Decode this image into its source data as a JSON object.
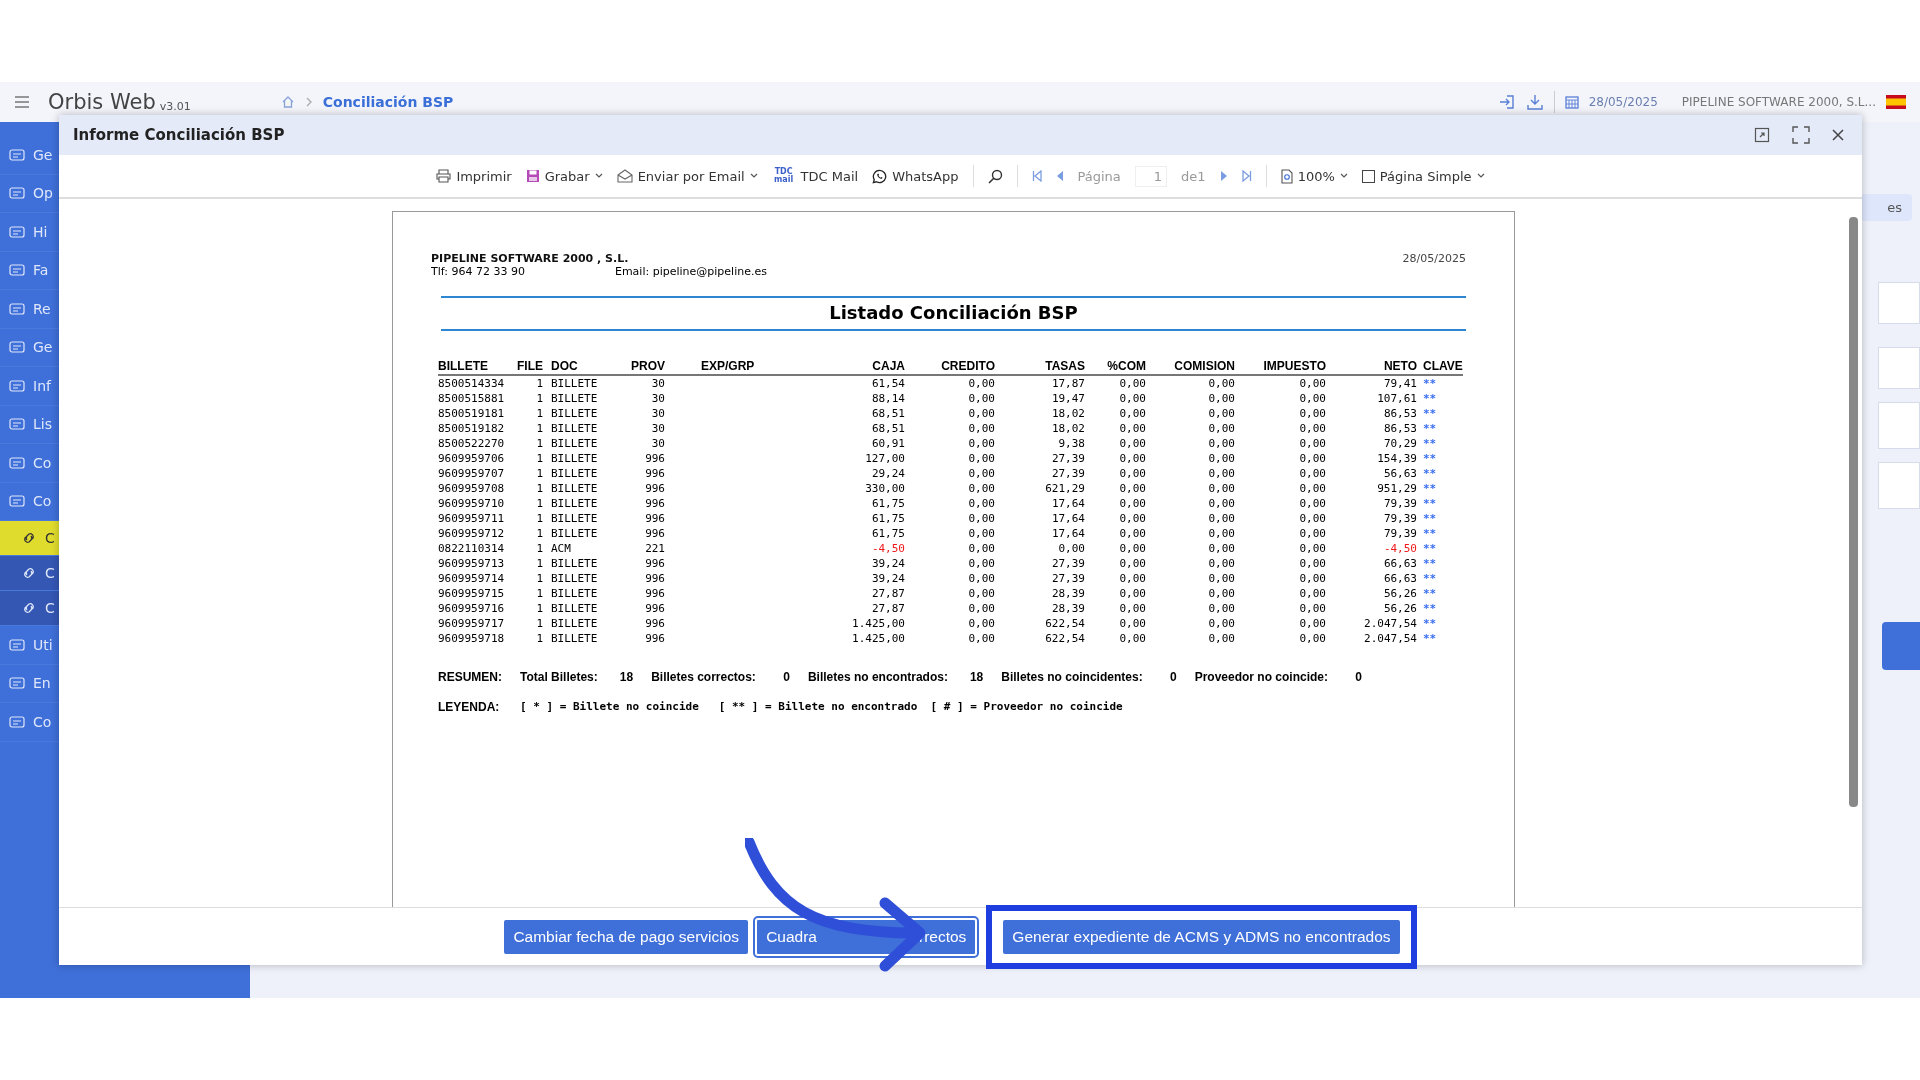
{
  "app": {
    "name": "Orbis Web",
    "version": "v3.01",
    "breadcrumb": "Conciliación BSP",
    "date": "28/05/2025",
    "company": "PIPELINE SOFTWARE 2000, S.L..."
  },
  "sidebar": {
    "items": [
      {
        "label": "Ge",
        "kind": "main",
        "selected": false
      },
      {
        "label": "Op",
        "kind": "main",
        "selected": false
      },
      {
        "label": "Hi",
        "kind": "main",
        "selected": false
      },
      {
        "label": "Fa",
        "kind": "main",
        "selected": false
      },
      {
        "label": "Re",
        "kind": "main",
        "selected": false
      },
      {
        "label": "Ge",
        "kind": "main",
        "selected": false
      },
      {
        "label": "Inf",
        "kind": "main",
        "selected": false
      },
      {
        "label": "Lis",
        "kind": "main",
        "selected": false
      },
      {
        "label": "Co",
        "kind": "main",
        "selected": false
      },
      {
        "label": "Co",
        "kind": "main",
        "selected": false
      },
      {
        "label": "C",
        "kind": "sub",
        "selected": true
      },
      {
        "label": "C",
        "kind": "sub",
        "selected": false
      },
      {
        "label": "C",
        "kind": "sub",
        "selected": false
      },
      {
        "label": "Uti",
        "kind": "main",
        "selected": false
      },
      {
        "label": "En",
        "kind": "main",
        "selected": false
      },
      {
        "label": "Co",
        "kind": "main",
        "selected": false
      }
    ]
  },
  "background": {
    "dropdown_label": "es"
  },
  "modal": {
    "title": "Informe Conciliación BSP",
    "toolbar": {
      "print": "Imprimir",
      "save": "Grabar",
      "email": "Enviar por Email",
      "tdc_icon": "TDC mail",
      "tdc": "TDC Mail",
      "whatsapp": "WhatsApp",
      "page_label": "Página",
      "page": "1",
      "page_of": "de1",
      "zoom": "100%",
      "view": "Página Simple"
    },
    "report": {
      "company": "PIPELINE SOFTWARE 2000 , S.L.",
      "phone": "Tlf:  964 72 33 90",
      "email": "Email:  pipeline@pipeline.es",
      "date": "28/05/2025",
      "title": "Listado Conciliación BSP",
      "columns": [
        "BILLETE",
        "FILE",
        "DOC",
        "PROV",
        "EXP/GRP",
        "CAJA",
        "CREDITO",
        "TASAS",
        "%COM",
        "COMISION",
        "IMPUESTO",
        "NETO",
        "CLAVE"
      ],
      "rows": [
        {
          "cells": [
            "8500514334",
            "1",
            "BILLETE",
            "30",
            "",
            "61,54",
            "0,00",
            "17,87",
            "0,00",
            "0,00",
            "0,00",
            "79,41",
            "**"
          ],
          "negative": false
        },
        {
          "cells": [
            "8500515881",
            "1",
            "BILLETE",
            "30",
            "",
            "88,14",
            "0,00",
            "19,47",
            "0,00",
            "0,00",
            "0,00",
            "107,61",
            "**"
          ],
          "negative": false
        },
        {
          "cells": [
            "8500519181",
            "1",
            "BILLETE",
            "30",
            "",
            "68,51",
            "0,00",
            "18,02",
            "0,00",
            "0,00",
            "0,00",
            "86,53",
            "**"
          ],
          "negative": false
        },
        {
          "cells": [
            "8500519182",
            "1",
            "BILLETE",
            "30",
            "",
            "68,51",
            "0,00",
            "18,02",
            "0,00",
            "0,00",
            "0,00",
            "86,53",
            "**"
          ],
          "negative": false
        },
        {
          "cells": [
            "8500522270",
            "1",
            "BILLETE",
            "30",
            "",
            "60,91",
            "0,00",
            "9,38",
            "0,00",
            "0,00",
            "0,00",
            "70,29",
            "**"
          ],
          "negative": false
        },
        {
          "cells": [
            "9609959706",
            "1",
            "BILLETE",
            "996",
            "",
            "127,00",
            "0,00",
            "27,39",
            "0,00",
            "0,00",
            "0,00",
            "154,39",
            "**"
          ],
          "negative": false
        },
        {
          "cells": [
            "9609959707",
            "1",
            "BILLETE",
            "996",
            "",
            "29,24",
            "0,00",
            "27,39",
            "0,00",
            "0,00",
            "0,00",
            "56,63",
            "**"
          ],
          "negative": false
        },
        {
          "cells": [
            "9609959708",
            "1",
            "BILLETE",
            "996",
            "",
            "330,00",
            "0,00",
            "621,29",
            "0,00",
            "0,00",
            "0,00",
            "951,29",
            "**"
          ],
          "negative": false
        },
        {
          "cells": [
            "9609959710",
            "1",
            "BILLETE",
            "996",
            "",
            "61,75",
            "0,00",
            "17,64",
            "0,00",
            "0,00",
            "0,00",
            "79,39",
            "**"
          ],
          "negative": false
        },
        {
          "cells": [
            "9609959711",
            "1",
            "BILLETE",
            "996",
            "",
            "61,75",
            "0,00",
            "17,64",
            "0,00",
            "0,00",
            "0,00",
            "79,39",
            "**"
          ],
          "negative": false
        },
        {
          "cells": [
            "9609959712",
            "1",
            "BILLETE",
            "996",
            "",
            "61,75",
            "0,00",
            "17,64",
            "0,00",
            "0,00",
            "0,00",
            "79,39",
            "**"
          ],
          "negative": false
        },
        {
          "cells": [
            "0822110314",
            "1",
            "ACM",
            "221",
            "",
            "-4,50",
            "0,00",
            "0,00",
            "0,00",
            "0,00",
            "0,00",
            "-4,50",
            "**"
          ],
          "negative": true
        },
        {
          "cells": [
            "9609959713",
            "1",
            "BILLETE",
            "996",
            "",
            "39,24",
            "0,00",
            "27,39",
            "0,00",
            "0,00",
            "0,00",
            "66,63",
            "**"
          ],
          "negative": false
        },
        {
          "cells": [
            "9609959714",
            "1",
            "BILLETE",
            "996",
            "",
            "39,24",
            "0,00",
            "27,39",
            "0,00",
            "0,00",
            "0,00",
            "66,63",
            "**"
          ],
          "negative": false
        },
        {
          "cells": [
            "9609959715",
            "1",
            "BILLETE",
            "996",
            "",
            "27,87",
            "0,00",
            "28,39",
            "0,00",
            "0,00",
            "0,00",
            "56,26",
            "**"
          ],
          "negative": false
        },
        {
          "cells": [
            "9609959716",
            "1",
            "BILLETE",
            "996",
            "",
            "27,87",
            "0,00",
            "28,39",
            "0,00",
            "0,00",
            "0,00",
            "56,26",
            "**"
          ],
          "negative": false
        },
        {
          "cells": [
            "9609959717",
            "1",
            "BILLETE",
            "996",
            "",
            "1.425,00",
            "0,00",
            "622,54",
            "0,00",
            "0,00",
            "0,00",
            "2.047,54",
            "**"
          ],
          "negative": false
        },
        {
          "cells": [
            "9609959718",
            "1",
            "BILLETE",
            "996",
            "",
            "1.425,00",
            "0,00",
            "622,54",
            "0,00",
            "0,00",
            "0,00",
            "2.047,54",
            "**"
          ],
          "negative": false
        }
      ],
      "summary_label": "RESUMEN:",
      "summary": [
        {
          "label": "Total Billetes:",
          "value": "18"
        },
        {
          "label": "Billetes correctos:",
          "value": "0"
        },
        {
          "label": "Billetes no encontrados:",
          "value": "18"
        },
        {
          "label": "Billetes no coincidentes:",
          "value": "0"
        },
        {
          "label": "Proveedor no coincide:",
          "value": "0"
        }
      ],
      "legend_label": "LEYENDA:",
      "legend": "[ * ] = Billete no coincide   [ ** ] = Billete no encontrado  [ # ] = Proveedor no coincide"
    },
    "buttons": [
      {
        "parts": [
          "Cambiar fecha de pago servicios"
        ],
        "highlighted": false
      },
      {
        "parts": [
          "Cuadra",
          "rrectos"
        ],
        "highlighted": false
      },
      {
        "parts": [
          "Generar expediente de ACMS y ADMS no encontrados"
        ],
        "highlighted": true
      }
    ]
  }
}
